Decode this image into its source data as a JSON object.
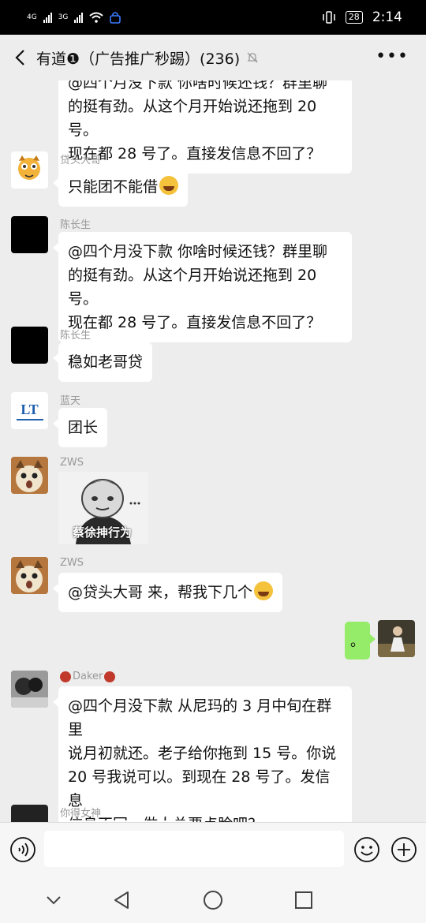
{
  "status_bar": {
    "signal1": "4G",
    "signal2": "3G",
    "battery": "28",
    "time": "2:14"
  },
  "header": {
    "title": "有道❶（广告推广秒踢）(236)",
    "more": "•••"
  },
  "messages": [
    {
      "sender": "",
      "text_lines": [
        "@四个月没下款 你啥时候还钱？群里聊",
        "的挺有劲。从这个月开始说还拖到 20 号。",
        "现在都 28 号了。直接发信息不回了？"
      ]
    },
    {
      "sender": "贷头大哥",
      "text": "只能团不能借"
    },
    {
      "sender": "陈长生",
      "text_lines": [
        "@四个月没下款 你啥时候还钱？群里聊",
        "的挺有劲。从这个月开始说还拖到 20 号。",
        "现在都 28 号了。直接发信息不回了？"
      ]
    },
    {
      "sender": "陈长生",
      "text": "稳如老哥贷"
    },
    {
      "sender": "蓝天",
      "text": "团长",
      "avatar_text": "LT"
    },
    {
      "sender": "ZWS",
      "sticker_caption": "蔡徐抻行为"
    },
    {
      "sender": "ZWS",
      "text": "@贷头大哥  来，帮我下几个"
    },
    {
      "sender": "me",
      "text": "。"
    },
    {
      "sender": "Daker",
      "text_lines": [
        "@四个月没下款 从尼玛的 3 月中旬在群里",
        "说月初就还。老子给你拖到 15 号。你说",
        "20 号我说可以。到现在 28 号了。发信息",
        "信息不回。做人总要点脸吧？"
      ]
    },
    {
      "sender": "你得女神",
      "text": ""
    }
  ],
  "input": {
    "placeholder": ""
  },
  "colors": {
    "background": "#ededed",
    "my_bubble": "#95ec69",
    "bubble": "#ffffff",
    "sender_name": "#999999"
  }
}
